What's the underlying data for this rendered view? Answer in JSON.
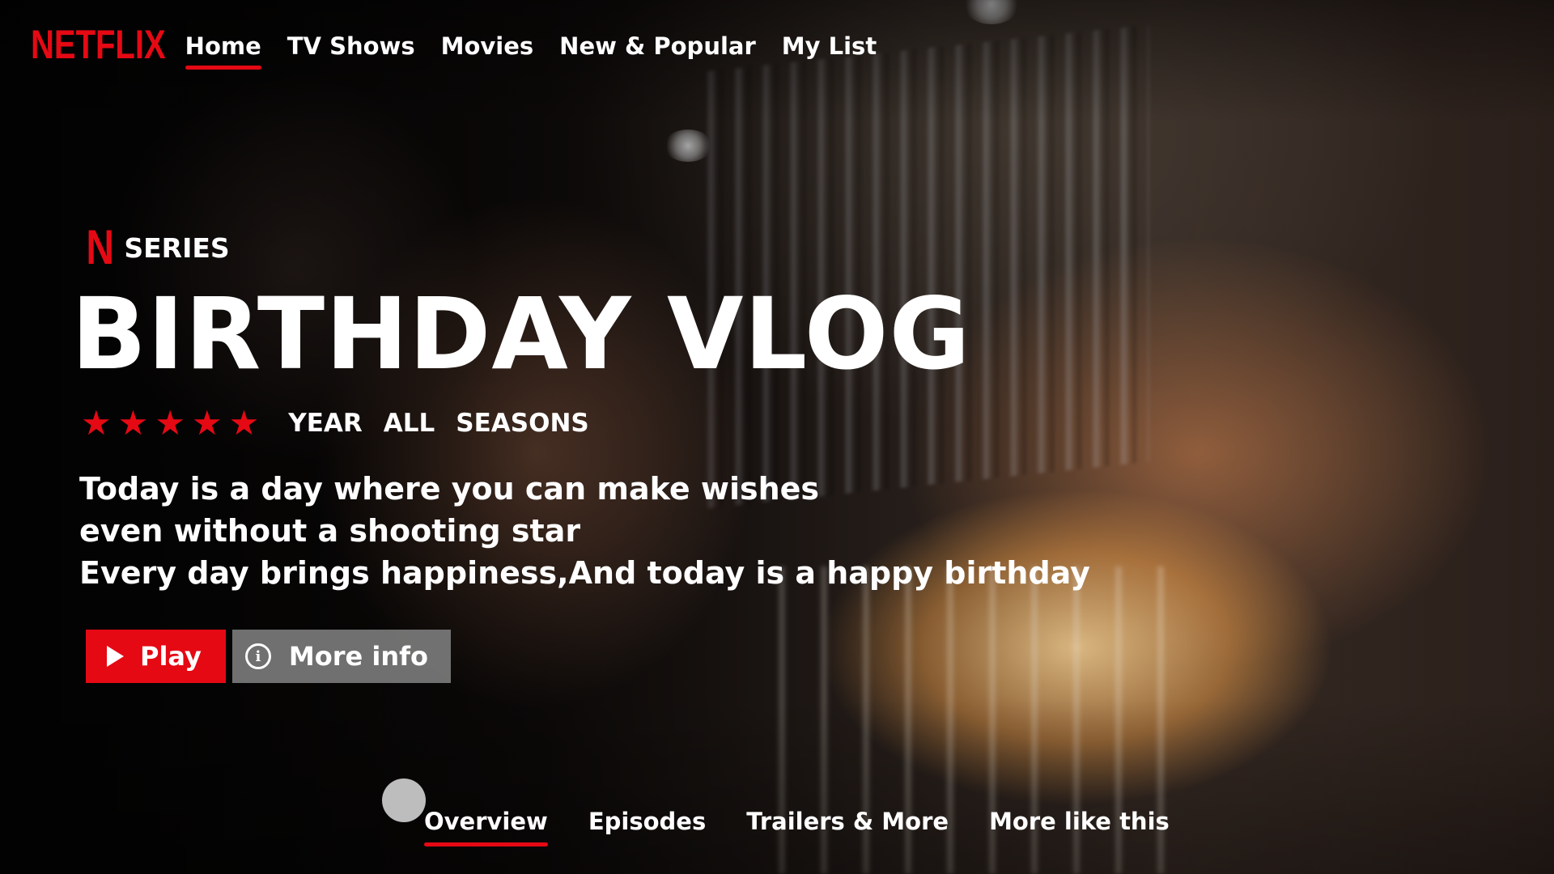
{
  "brand": {
    "logo_text": "NETFLIX",
    "badge_letter": "N",
    "accent_color": "#e50914"
  },
  "nav": {
    "items": [
      {
        "label": "Home",
        "active": true
      },
      {
        "label": "TV Shows",
        "active": false
      },
      {
        "label": "Movies",
        "active": false
      },
      {
        "label": "New & Popular",
        "active": false
      },
      {
        "label": "My List",
        "active": false
      }
    ]
  },
  "hero": {
    "type_label": "SERIES",
    "title": "BIRTHDAY VLOG",
    "rating_stars": 5,
    "rating_icon": "star-icon",
    "meta": [
      "YEAR",
      "ALL",
      "SEASONS"
    ],
    "description_lines": [
      "Today is a day where you can make wishes",
      "even without a shooting star",
      "Every day brings happiness,And today is a happy birthday"
    ],
    "play_label": "Play",
    "play_icon": "play-icon",
    "info_label": "More info",
    "info_icon": "info-icon"
  },
  "tabs": [
    {
      "label": "Overview",
      "active": true
    },
    {
      "label": "Episodes",
      "active": false
    },
    {
      "label": "Trailers & More",
      "active": false
    },
    {
      "label": "More like this",
      "active": false
    }
  ]
}
